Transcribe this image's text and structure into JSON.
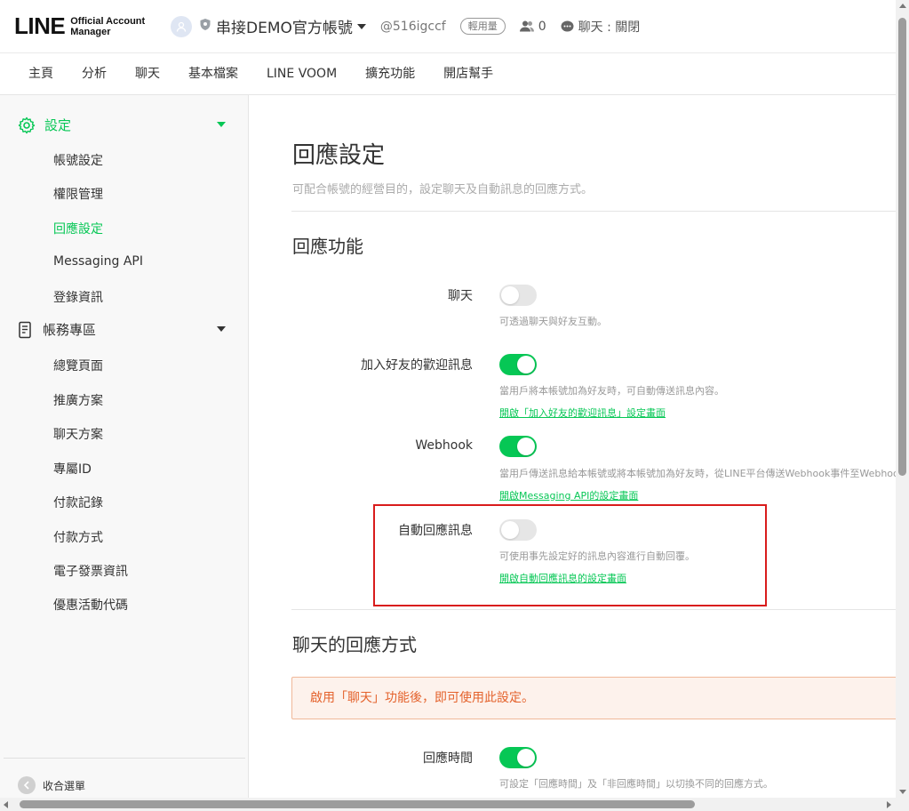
{
  "header": {
    "logo_main": "LINE",
    "logo_sub_1": "Official Account",
    "logo_sub_2": "Manager",
    "account_name": "串接DEMO官方帳號",
    "account_id": "@516igccf",
    "plan_badge": "輕用量",
    "friend_count": "0",
    "chat_status": "聊天 : 關閉"
  },
  "nav": {
    "items": [
      "主頁",
      "分析",
      "聊天",
      "基本檔案",
      "LINE VOOM",
      "擴充功能",
      "開店幫手"
    ]
  },
  "sidebar": {
    "group_settings": "設定",
    "settings_items": [
      "帳號設定",
      "權限管理",
      "回應設定",
      "Messaging API",
      "登錄資訊"
    ],
    "group_billing": "帳務專區",
    "billing_items": [
      "總覽頁面",
      "推廣方案",
      "聊天方案",
      "專屬ID",
      "付款記錄",
      "付款方式",
      "電子發票資訊",
      "優惠活動代碼"
    ],
    "collapse_label": "收合選單"
  },
  "main": {
    "title": "回應設定",
    "description": "可配合帳號的經營目的，設定聊天及自動訊息的回應方式。",
    "section1_title": "回應功能",
    "rows": [
      {
        "label": "聊天",
        "state": "off",
        "desc": "可透過聊天與好友互動。",
        "link": ""
      },
      {
        "label": "加入好友的歡迎訊息",
        "state": "on",
        "desc": "當用戶將本帳號加為好友時，可自動傳送訊息內容。",
        "link": "開啟「加入好友的歡迎訊息」設定畫面"
      },
      {
        "label": "Webhook",
        "state": "on",
        "desc": "當用戶傳送訊息給本帳號或將本帳號加為好友時，從LINE平台傳送Webhook事件至Webhook URL。",
        "link": "開啟Messaging API的設定畫面"
      },
      {
        "label": "自動回應訊息",
        "state": "off",
        "desc": "可使用事先設定好的訊息內容進行自動回覆。",
        "link": "開啟自動回應訊息的設定畫面"
      }
    ],
    "section2_title": "聊天的回應方式",
    "notice": "啟用「聊天」功能後，即可使用此設定。",
    "response_time_label": "回應時間",
    "response_time_state": "on",
    "response_time_desc": "可設定「回應時間」及「非回應時間」以切換不同的回應方式。"
  },
  "colors": {
    "accent": "#06c755",
    "highlight_border": "#d91c1c",
    "notice_text": "#e4622c"
  }
}
